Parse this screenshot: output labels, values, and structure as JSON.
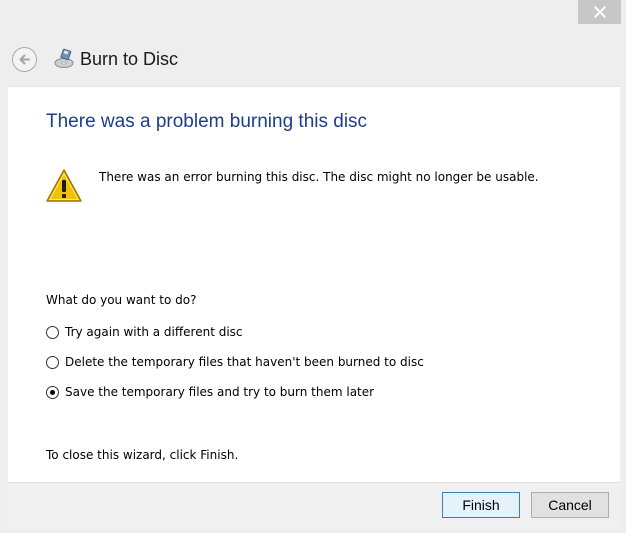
{
  "window": {
    "title": "Burn to Disc"
  },
  "icons": {
    "close": "close-icon",
    "back": "back-arrow-icon",
    "app": "burn-disc-icon",
    "warning": "warning-icon"
  },
  "colors": {
    "heading": "#1e3e8c",
    "warning_fill": "#f2c200",
    "default_button_border": "#3c7fb1"
  },
  "content": {
    "heading": "There was a problem burning this disc",
    "error_message": "There was an error burning this disc. The disc might no longer be usable.",
    "question": "What do you want to do?",
    "options": [
      {
        "label": "Try again with a different disc",
        "selected": false
      },
      {
        "label": "Delete the temporary files that haven't been burned to disc",
        "selected": false
      },
      {
        "label": "Save the temporary files and try to burn them later",
        "selected": true
      }
    ],
    "closing_note": "To close this wizard, click Finish."
  },
  "buttons": {
    "finish": "Finish",
    "cancel": "Cancel"
  }
}
